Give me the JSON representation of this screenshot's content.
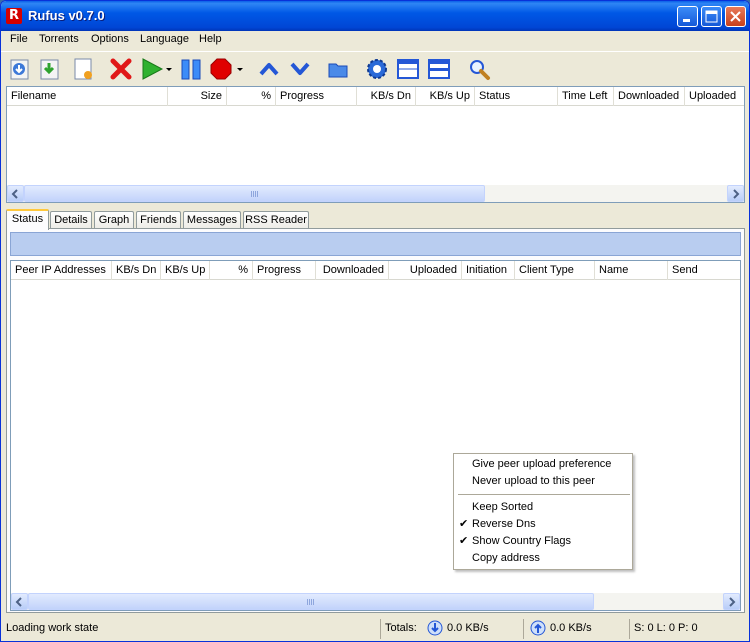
{
  "window": {
    "title": "Rufus v0.7.0",
    "app_icon_letter": "R"
  },
  "menu": [
    {
      "label": "File"
    },
    {
      "label": "Torrents"
    },
    {
      "label": "Options"
    },
    {
      "label": "Language"
    },
    {
      "label": "Help"
    }
  ],
  "toolbar": {
    "icons": [
      "add-torrent-icon",
      "add-torrent-url-icon",
      "new-torrent-icon",
      "remove-icon",
      "start-icon",
      "pause-icon",
      "stop-icon",
      "move-up-icon",
      "move-down-icon",
      "open-folder-icon",
      "settings-icon",
      "layout-single-icon",
      "layout-split-icon",
      "search-icon"
    ]
  },
  "torrent_list": {
    "columns": [
      "Filename",
      "Size",
      "%",
      "Progress",
      "KB/s Dn",
      "KB/s Up",
      "Status",
      "Time Left",
      "Downloaded",
      "Uploaded"
    ]
  },
  "tabs": [
    {
      "label": "Status",
      "active": true
    },
    {
      "label": "Details"
    },
    {
      "label": "Graph"
    },
    {
      "label": "Friends"
    },
    {
      "label": "Messages"
    },
    {
      "label": "RSS Reader"
    }
  ],
  "peer_list": {
    "columns": [
      "Peer IP Addresses",
      "KB/s Dn",
      "KB/s Up",
      "%",
      "Progress",
      "Downloaded",
      "Uploaded",
      "Initiation",
      "Client Type",
      "Name",
      "Send"
    ]
  },
  "context_menu": {
    "group1": [
      {
        "label": "Give peer upload preference"
      },
      {
        "label": "Never upload to this peer"
      }
    ],
    "group2": [
      {
        "label": "Keep Sorted",
        "checked": false
      },
      {
        "label": "Reverse Dns",
        "checked": true
      },
      {
        "label": "Show Country Flags",
        "checked": true
      },
      {
        "label": "Copy address",
        "checked": false
      }
    ],
    "check_glyph": "✔"
  },
  "status_bar": {
    "state": "Loading work state",
    "totals_label": "Totals:",
    "down_rate": "0.0 KB/s",
    "up_rate": "0.0 KB/s",
    "counts": "S: 0 L: 0 P: 0"
  },
  "colors": {
    "title_bar": "#0058e6",
    "accent_green": "#2fb12f",
    "stop_red": "#e00000",
    "arrow_blue": "#2457d6"
  }
}
